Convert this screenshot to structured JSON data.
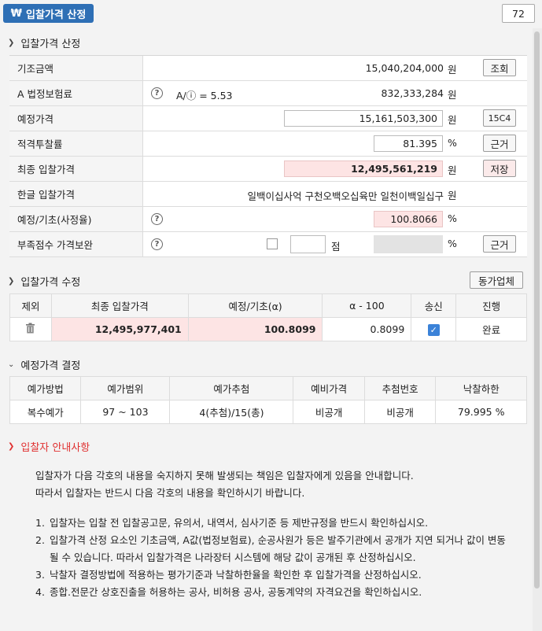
{
  "header": {
    "title": "입찰가격 산정",
    "title_icon": "won-sign-icon",
    "page_number": "72"
  },
  "section_calc": {
    "title": "입찰가격 산정",
    "rows": {
      "base": {
        "label": "기조금액",
        "value": "15,040,204,000",
        "unit": "원",
        "button": "조회"
      },
      "a_law": {
        "label": "A 법정보험료",
        "formula": "A/ⓘ = 5.53",
        "value": "832,333,284",
        "unit": "원"
      },
      "expected": {
        "label": "예정가격",
        "value": "15,161,503,300",
        "unit": "원",
        "button": "15C4"
      },
      "rate": {
        "label": "적격투찰률",
        "value": "81.395",
        "unit": "%",
        "button": "근거"
      },
      "final": {
        "label": "최종 입찰가격",
        "value": "12,495,561,219",
        "unit": "원",
        "button": "저장"
      },
      "hangul": {
        "label": "한글 입찰가격",
        "value": "일백이십사억 구천오백오십육만 일천이백일십구",
        "unit": "원"
      },
      "ratio": {
        "label": "예정/기초(사정율)",
        "value": "100.8066",
        "unit": "%"
      },
      "shortage": {
        "label": "부족점수 가격보완",
        "points_unit": "점",
        "unit": "%",
        "button": "근거"
      }
    }
  },
  "section_modify": {
    "title": "입찰가격 수정",
    "button": "동가업체",
    "headers": [
      "제외",
      "최종 입찰가격",
      "예정/기초(α)",
      "α - 100",
      "송신",
      "진행"
    ],
    "row": {
      "final": "12,495,977,401",
      "ratio": "100.8099",
      "alpha": "0.8099",
      "status": "완료"
    }
  },
  "section_decide": {
    "title": "예정가격 결정",
    "headers": [
      "예가방법",
      "예가범위",
      "예가추첨",
      "예비가격",
      "추첨번호",
      "낙찰하한"
    ],
    "row": [
      "복수예가",
      "97 ~ 103",
      "4(추첨)/15(총)",
      "비공개",
      "비공개",
      "79.995 %"
    ]
  },
  "notice": {
    "title": "입찰자 안내사항",
    "p1": "입찰자가 다음 각호의 내용을 숙지하지 못해 발생되는 책임은 입찰자에게 있음을 안내합니다.",
    "p2": "따라서 입찰자는 반드시 다음 각호의 내용을 확인하시기 바랍니다.",
    "items": [
      {
        "n": "1.",
        "text": "입찰자는 입찰 전 입찰공고문, 유의서, 내역서, 심사기준 등 제반규정을 반드시 확인하십시오."
      },
      {
        "n": "2.",
        "text": "입찰가격 산정 요소인 기초금액, A값(법정보험료), 순공사원가 등은 발주기관에서 공개가 지연 되거나 값이 변동될 수 있습니다. 따라서 입찰가격은 나라장터 시스템에 해당 값이 공개된 후 산정하십시오."
      },
      {
        "n": "3.",
        "text": "낙찰자 결정방법에 적용하는 평가기준과 낙찰하한율을 확인한 후 입찰가격을 산정하십시오."
      },
      {
        "n": "4.",
        "text": "종합.전문간 상호진출을 허용하는 공사, 비허용 공사, 공동계약의 자격요건을 확인하십시오."
      }
    ]
  },
  "colors": {
    "accent": "#2e6fb5",
    "pink_field": "#fde4e4",
    "notice_red": "#e03030",
    "check_blue": "#3b82d8"
  }
}
